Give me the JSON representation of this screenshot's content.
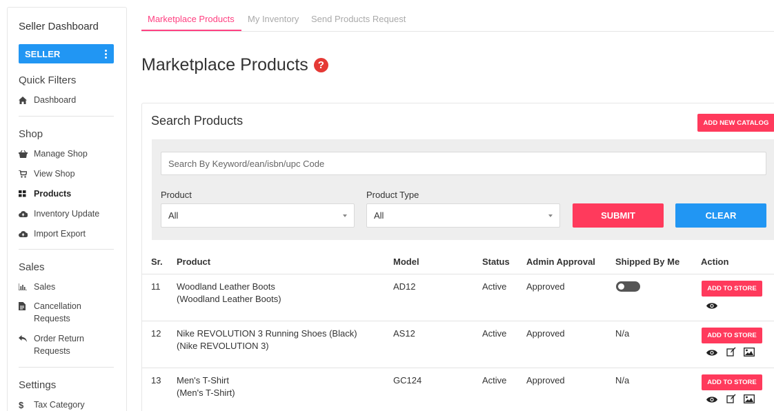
{
  "sidebar": {
    "title": "Seller Dashboard",
    "role_button": "SELLER",
    "quick_filters": {
      "heading": "Quick Filters",
      "items": [
        {
          "label": "Dashboard",
          "icon": "home-icon"
        }
      ]
    },
    "shop": {
      "heading": "Shop",
      "items": [
        {
          "label": "Manage Shop",
          "icon": "basket-icon"
        },
        {
          "label": "View Shop",
          "icon": "cart-icon"
        },
        {
          "label": "Products",
          "icon": "grid-icon",
          "active": true
        },
        {
          "label": "Inventory Update",
          "icon": "cloud-upload-icon"
        },
        {
          "label": "Import Export",
          "icon": "cloud-upload-icon"
        }
      ]
    },
    "sales": {
      "heading": "Sales",
      "items": [
        {
          "label": "Sales",
          "icon": "bar-chart-icon"
        },
        {
          "label_line1": "Cancellation",
          "label_line2": "Requests",
          "icon": "document-icon"
        },
        {
          "label_line1": "Order Return",
          "label_line2": "Requests",
          "icon": "reply-icon"
        }
      ]
    },
    "settings": {
      "heading": "Settings",
      "items": [
        {
          "label": "Tax Category",
          "icon": "dollar-icon"
        }
      ]
    }
  },
  "tabs": [
    {
      "label": "Marketplace Products",
      "active": true
    },
    {
      "label": "My Inventory"
    },
    {
      "label": "Send Products Request"
    }
  ],
  "page_title": "Marketplace Products",
  "search_card": {
    "title": "Search Products",
    "add_catalog_label": "ADD NEW CATALOG",
    "search_placeholder": "Search By Keyword/ean/isbn/upc Code",
    "product_label": "Product",
    "product_value": "All",
    "product_type_label": "Product Type",
    "product_type_value": "All",
    "submit_label": "SUBMIT",
    "clear_label": "CLEAR"
  },
  "table": {
    "headers": [
      "Sr.",
      "Product",
      "Model",
      "Status",
      "Admin Approval",
      "Shipped By Me",
      "Action"
    ],
    "add_to_store_label": "ADD TO STORE",
    "rows": [
      {
        "sr": "11",
        "name": "Woodland Leather Boots",
        "sub": "(Woodland Leather Boots)",
        "model": "AD12",
        "status": "Active",
        "approval": "Approved",
        "shipped": "",
        "shipped_toggle": true
      },
      {
        "sr": "12",
        "name": "Nike REVOLUTION 3 Running Shoes (Black)",
        "sub": "(Nike REVOLUTION 3)",
        "model": "AS12",
        "status": "Active",
        "approval": "Approved",
        "shipped": "N/a"
      },
      {
        "sr": "13",
        "name": "Men's T-Shirt",
        "sub": "(Men's T-Shirt)",
        "model": "GC124",
        "status": "Active",
        "approval": "Approved",
        "shipped": "N/a"
      }
    ]
  },
  "colors": {
    "primary_blue": "#2196f3",
    "accent_red": "#ff3a5c",
    "tab_active": "#ff4081",
    "help_red": "#e53935"
  }
}
